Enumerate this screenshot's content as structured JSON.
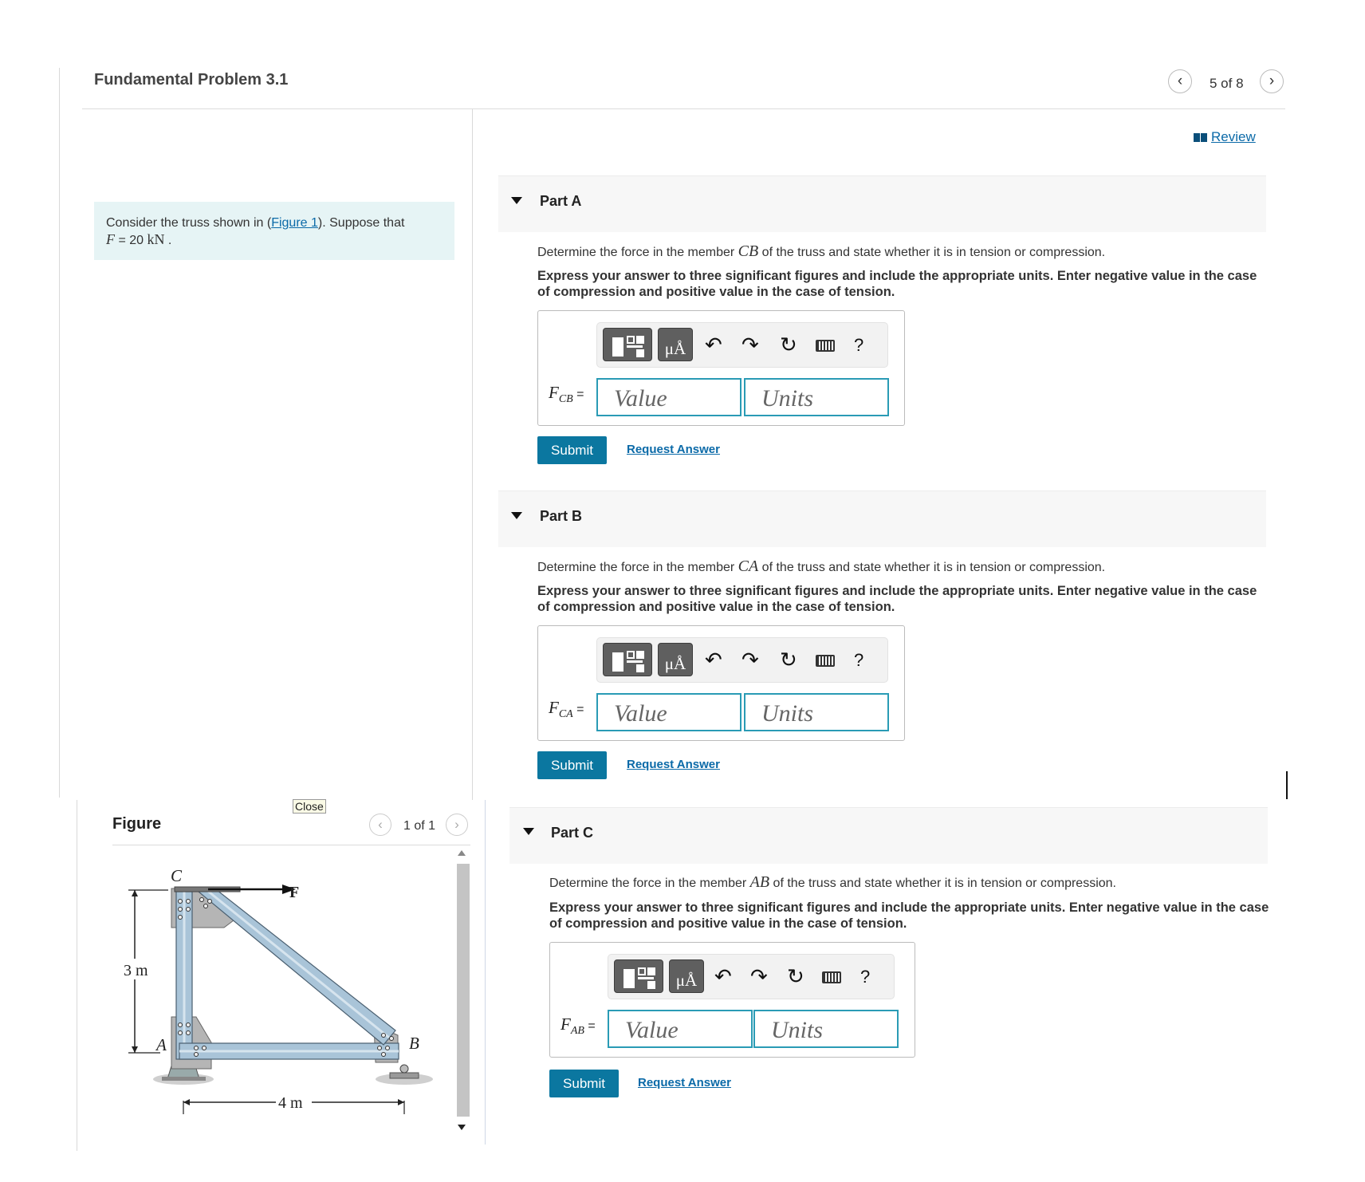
{
  "header": {
    "title": "Fundamental Problem 3.1",
    "pager_text": "5 of 8",
    "prev_icon": "chevron-left-icon",
    "next_icon": "chevron-right-icon",
    "review_label": "Review",
    "review_icon": "book-icon"
  },
  "problem": {
    "text_before": "Consider the truss shown in (",
    "figure_link": "Figure 1",
    "text_after": "). Suppose that",
    "given_var": "F",
    "given_eq": " = 20 ",
    "given_unit": "kN",
    "given_end": " ."
  },
  "toolbar": {
    "template_icon": "templates-icon",
    "units_symbol": "μÅ",
    "undo_icon": "↶",
    "redo_icon": "↷",
    "reset_icon": "↻",
    "keyboard_icon": "keyboard-icon",
    "help_icon": "?"
  },
  "parts": [
    {
      "label": "Part A",
      "question_before": "Determine the force in the member ",
      "member": "CB",
      "question_after": " of the truss and state whether it is in tension or compression.",
      "instructions": "Express your answer to three significant figures and include the appropriate units. Enter negative value in the case of compression and positive value in the case of tension.",
      "var": "F",
      "sub": "CB",
      "eq": " =",
      "value_placeholder": "Value",
      "units_placeholder": "Units",
      "submit": "Submit",
      "request": "Request Answer"
    },
    {
      "label": "Part B",
      "question_before": "Determine the force in the member ",
      "member": "CA",
      "question_after": " of the truss and state whether it is in tension or compression.",
      "instructions": "Express your answer to three significant figures and include the appropriate units. Enter negative value in the case of compression and positive value in the case of tension.",
      "var": "F",
      "sub": "CA",
      "eq": " =",
      "value_placeholder": "Value",
      "units_placeholder": "Units",
      "submit": "Submit",
      "request": "Request Answer"
    },
    {
      "label": "Part C",
      "question_before": "Determine the force in the member ",
      "member": "AB",
      "question_after": " of the truss and state whether it is in tension or compression.",
      "instructions": "Express your answer to three significant figures and include the appropriate units. Enter negative value in the case of compression and positive value in the case of tension.",
      "var": "F",
      "sub": "AB",
      "eq": " =",
      "value_placeholder": "Value",
      "units_placeholder": "Units",
      "submit": "Submit",
      "request": "Request Answer"
    }
  ],
  "figure": {
    "title": "Figure",
    "close": "Close",
    "pager_text": "1 of 1",
    "labels": {
      "C": "C",
      "A": "A",
      "B": "B",
      "F": "F",
      "height": "3 m",
      "width": "4 m"
    }
  },
  "colors": {
    "accent": "#0b77a0",
    "link": "#0b6aa8",
    "input_border": "#2a9bb5",
    "problem_bg": "#e6f4f5",
    "truss_member": "#a9c4d8",
    "gusset": "#b5b5b5"
  }
}
